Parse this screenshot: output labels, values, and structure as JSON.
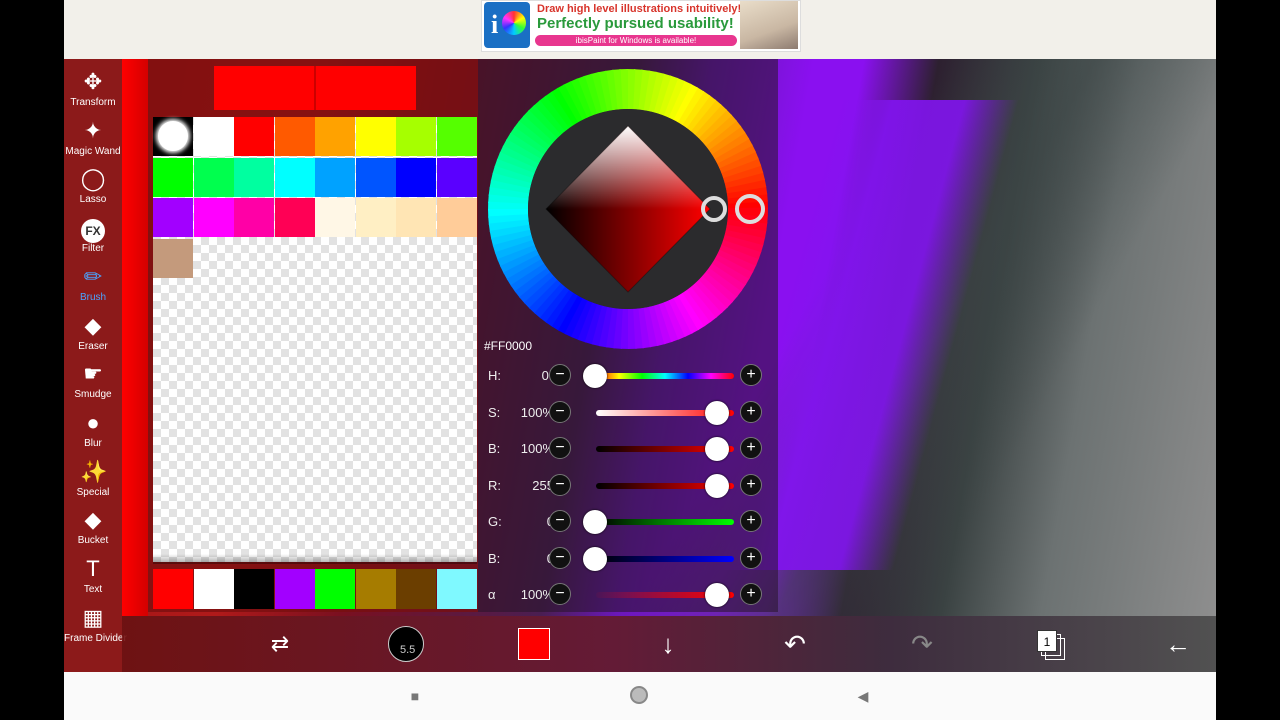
{
  "ad": {
    "line1": "Draw high level illustrations intuitively!",
    "line2": "Perfectly pursued usability!",
    "line3": "ibisPaint for Windows is available!",
    "logo_icon": "ibispaint-logo-icon"
  },
  "tools": [
    {
      "label": "Transform",
      "icon": "✥",
      "icon_name": "transform-icon"
    },
    {
      "label": "Magic Wand",
      "icon": "✦",
      "icon_name": "magic-wand-icon"
    },
    {
      "label": "Lasso",
      "icon": "◯",
      "icon_name": "lasso-icon"
    },
    {
      "label": "Filter",
      "icon": "FX",
      "icon_name": "filter-icon"
    },
    {
      "label": "Brush",
      "icon": "✏",
      "icon_name": "brush-icon",
      "active": true
    },
    {
      "label": "Eraser",
      "icon": "◆",
      "icon_name": "eraser-icon"
    },
    {
      "label": "Smudge",
      "icon": "☛",
      "icon_name": "smudge-icon"
    },
    {
      "label": "Blur",
      "icon": "●",
      "icon_name": "blur-icon"
    },
    {
      "label": "Special",
      "icon": "✨",
      "icon_name": "special-icon"
    },
    {
      "label": "Bucket",
      "icon": "◆",
      "icon_name": "bucket-icon"
    },
    {
      "label": "Text",
      "icon": "T",
      "icon_name": "text-icon"
    },
    {
      "label": "Frame Divider",
      "icon": "▦",
      "icon_name": "frame-divider-icon"
    }
  ],
  "palette": {
    "current_color": "#FF0000",
    "swatches": [
      "#000000",
      "#ffffff",
      "#ff0000",
      "#ff5a00",
      "#ffa200",
      "#ffff00",
      "#a6ff00",
      "#55ff00",
      "#00ff00",
      "#00ff4e",
      "#00ffa0",
      "#00ffff",
      "#00a2ff",
      "#0055ff",
      "#0000ff",
      "#5a00ff",
      "#a200ff",
      "#ff00ff",
      "#ff00a6",
      "#ff0055",
      "#fff7e6",
      "#ffefc4",
      "#ffe5b4",
      "#ffcc99",
      "#c49a7c"
    ],
    "history": [
      "#ff0000",
      "#ffffff",
      "#000000",
      "#a200ff",
      "#00ff00",
      "#a67c00",
      "#6b3e00",
      "#7ff9ff"
    ]
  },
  "color_picker": {
    "hex": "#FF0000",
    "sliders": [
      {
        "name": "H:",
        "value": "0°",
        "knob": 0.0,
        "track": "hue"
      },
      {
        "name": "S:",
        "value": "100%",
        "knob": 1.0,
        "track": "sat"
      },
      {
        "name": "B:",
        "value": "100%",
        "knob": 1.0,
        "track": "bri"
      },
      {
        "name": "R:",
        "value": "255",
        "knob": 1.0,
        "track": "red"
      },
      {
        "name": "G:",
        "value": "0",
        "knob": 0.0,
        "track": "green"
      },
      {
        "name": "B:",
        "value": "0",
        "knob": 0.0,
        "track": "blue"
      },
      {
        "name": "α",
        "value": "100%",
        "knob": 1.0,
        "track": "alpha"
      }
    ],
    "minus": "−",
    "plus": "+"
  },
  "bottom_bar": {
    "brush_size": "5.5",
    "layer_number": "1",
    "undo_icon": "↶",
    "redo_icon": "↷",
    "down_icon": "↓",
    "back_icon": "←",
    "swap_icon": "⇄"
  },
  "nav": {
    "square": "■",
    "circle": "●",
    "triangle": "◀"
  }
}
